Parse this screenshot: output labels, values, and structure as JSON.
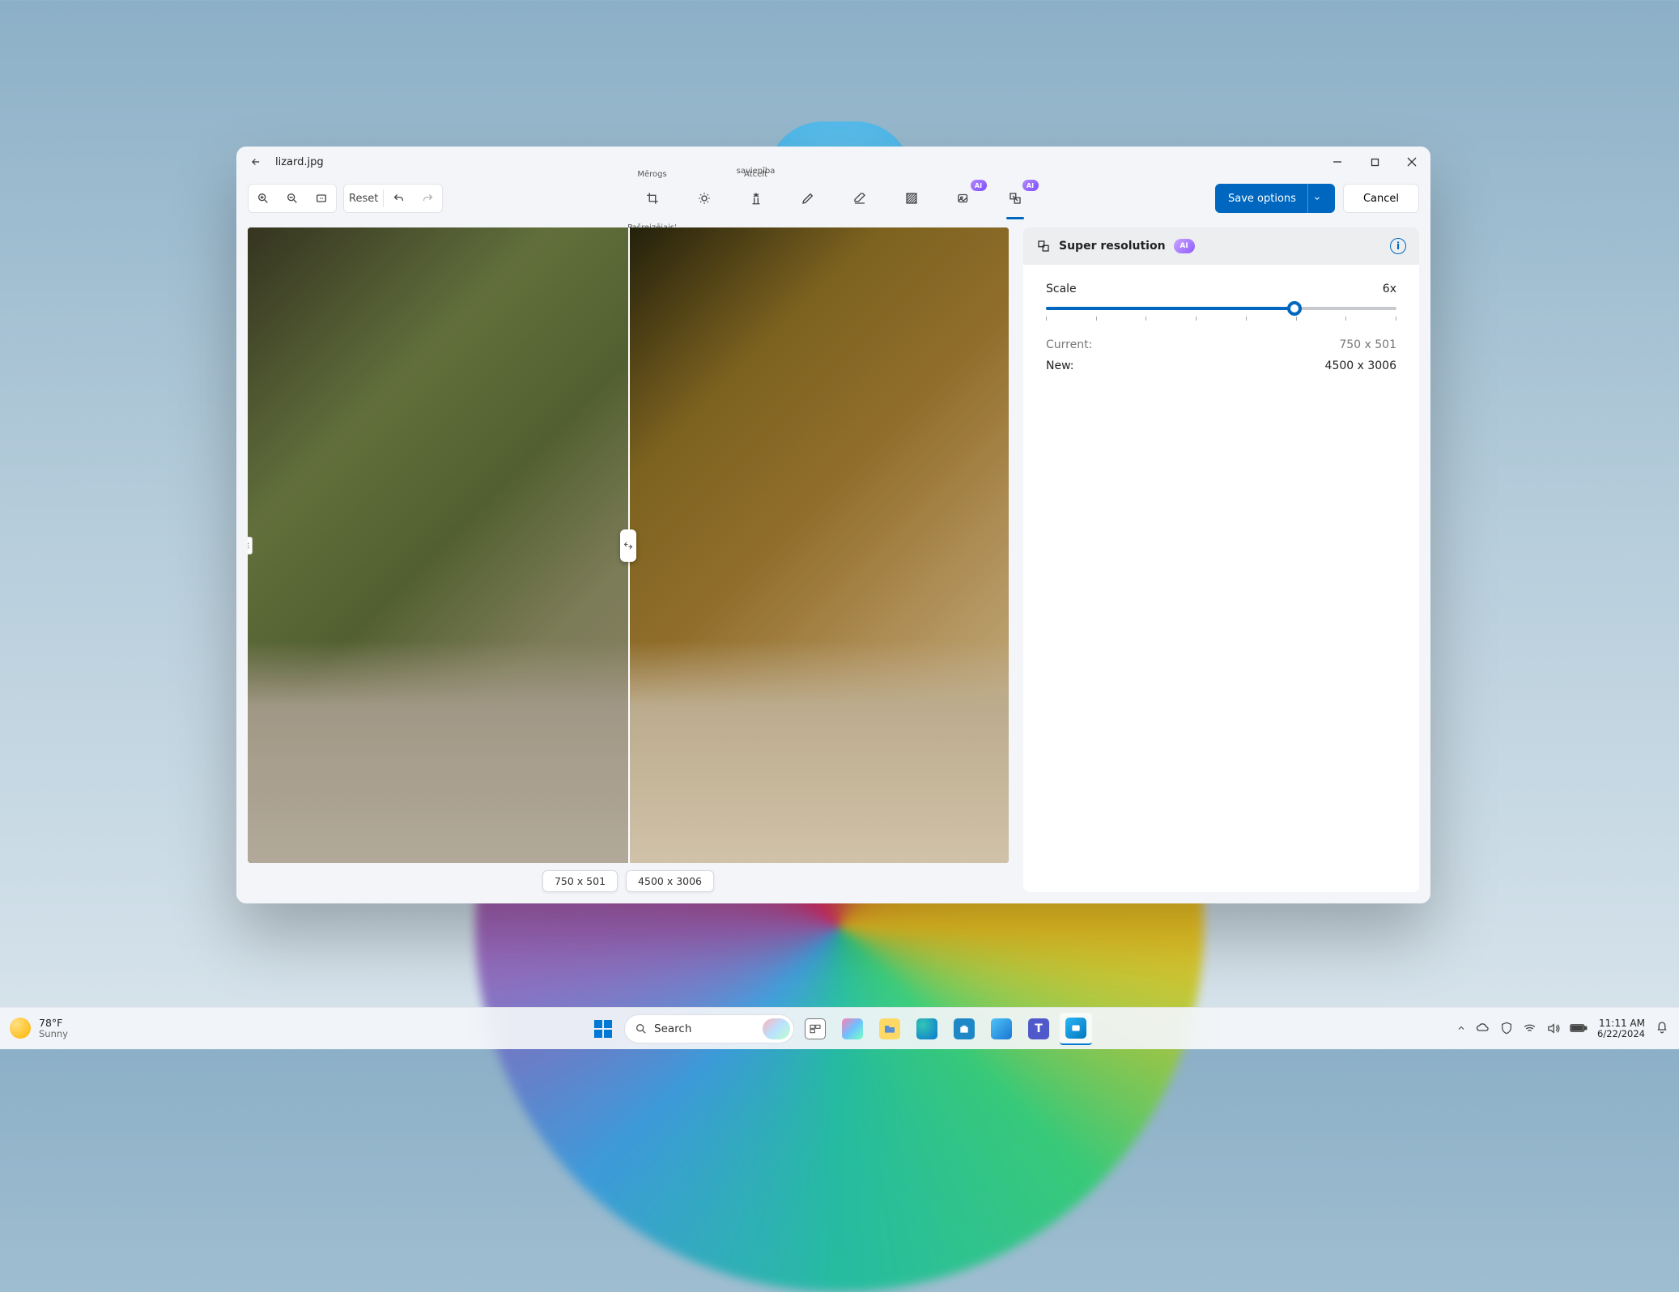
{
  "window": {
    "filename": "lizard.jpg"
  },
  "toolbar": {
    "reset": "Reset",
    "crop_label": "Mērogs",
    "crop_sublabel": "Pašreizējais'",
    "erase_label": "savienība",
    "remove_label": "Atcelt",
    "ai": "AI",
    "save": "Save options",
    "cancel": "Cancel"
  },
  "canvas": {
    "left_dim": "750 x 501",
    "right_dim": "4500 x 3006"
  },
  "panel": {
    "title": "Super resolution",
    "ai": "AI",
    "scale_label": "Scale",
    "scale_value": "6x",
    "current_label": "Current:",
    "current_value": "750 x 501",
    "new_label": "New:",
    "new_value": "4500 x 3006"
  },
  "taskbar": {
    "weather_temp": "78°F",
    "weather_cond": "Sunny",
    "search_placeholder": "Search",
    "time": "11:11 AM",
    "date": "6/22/2024"
  }
}
